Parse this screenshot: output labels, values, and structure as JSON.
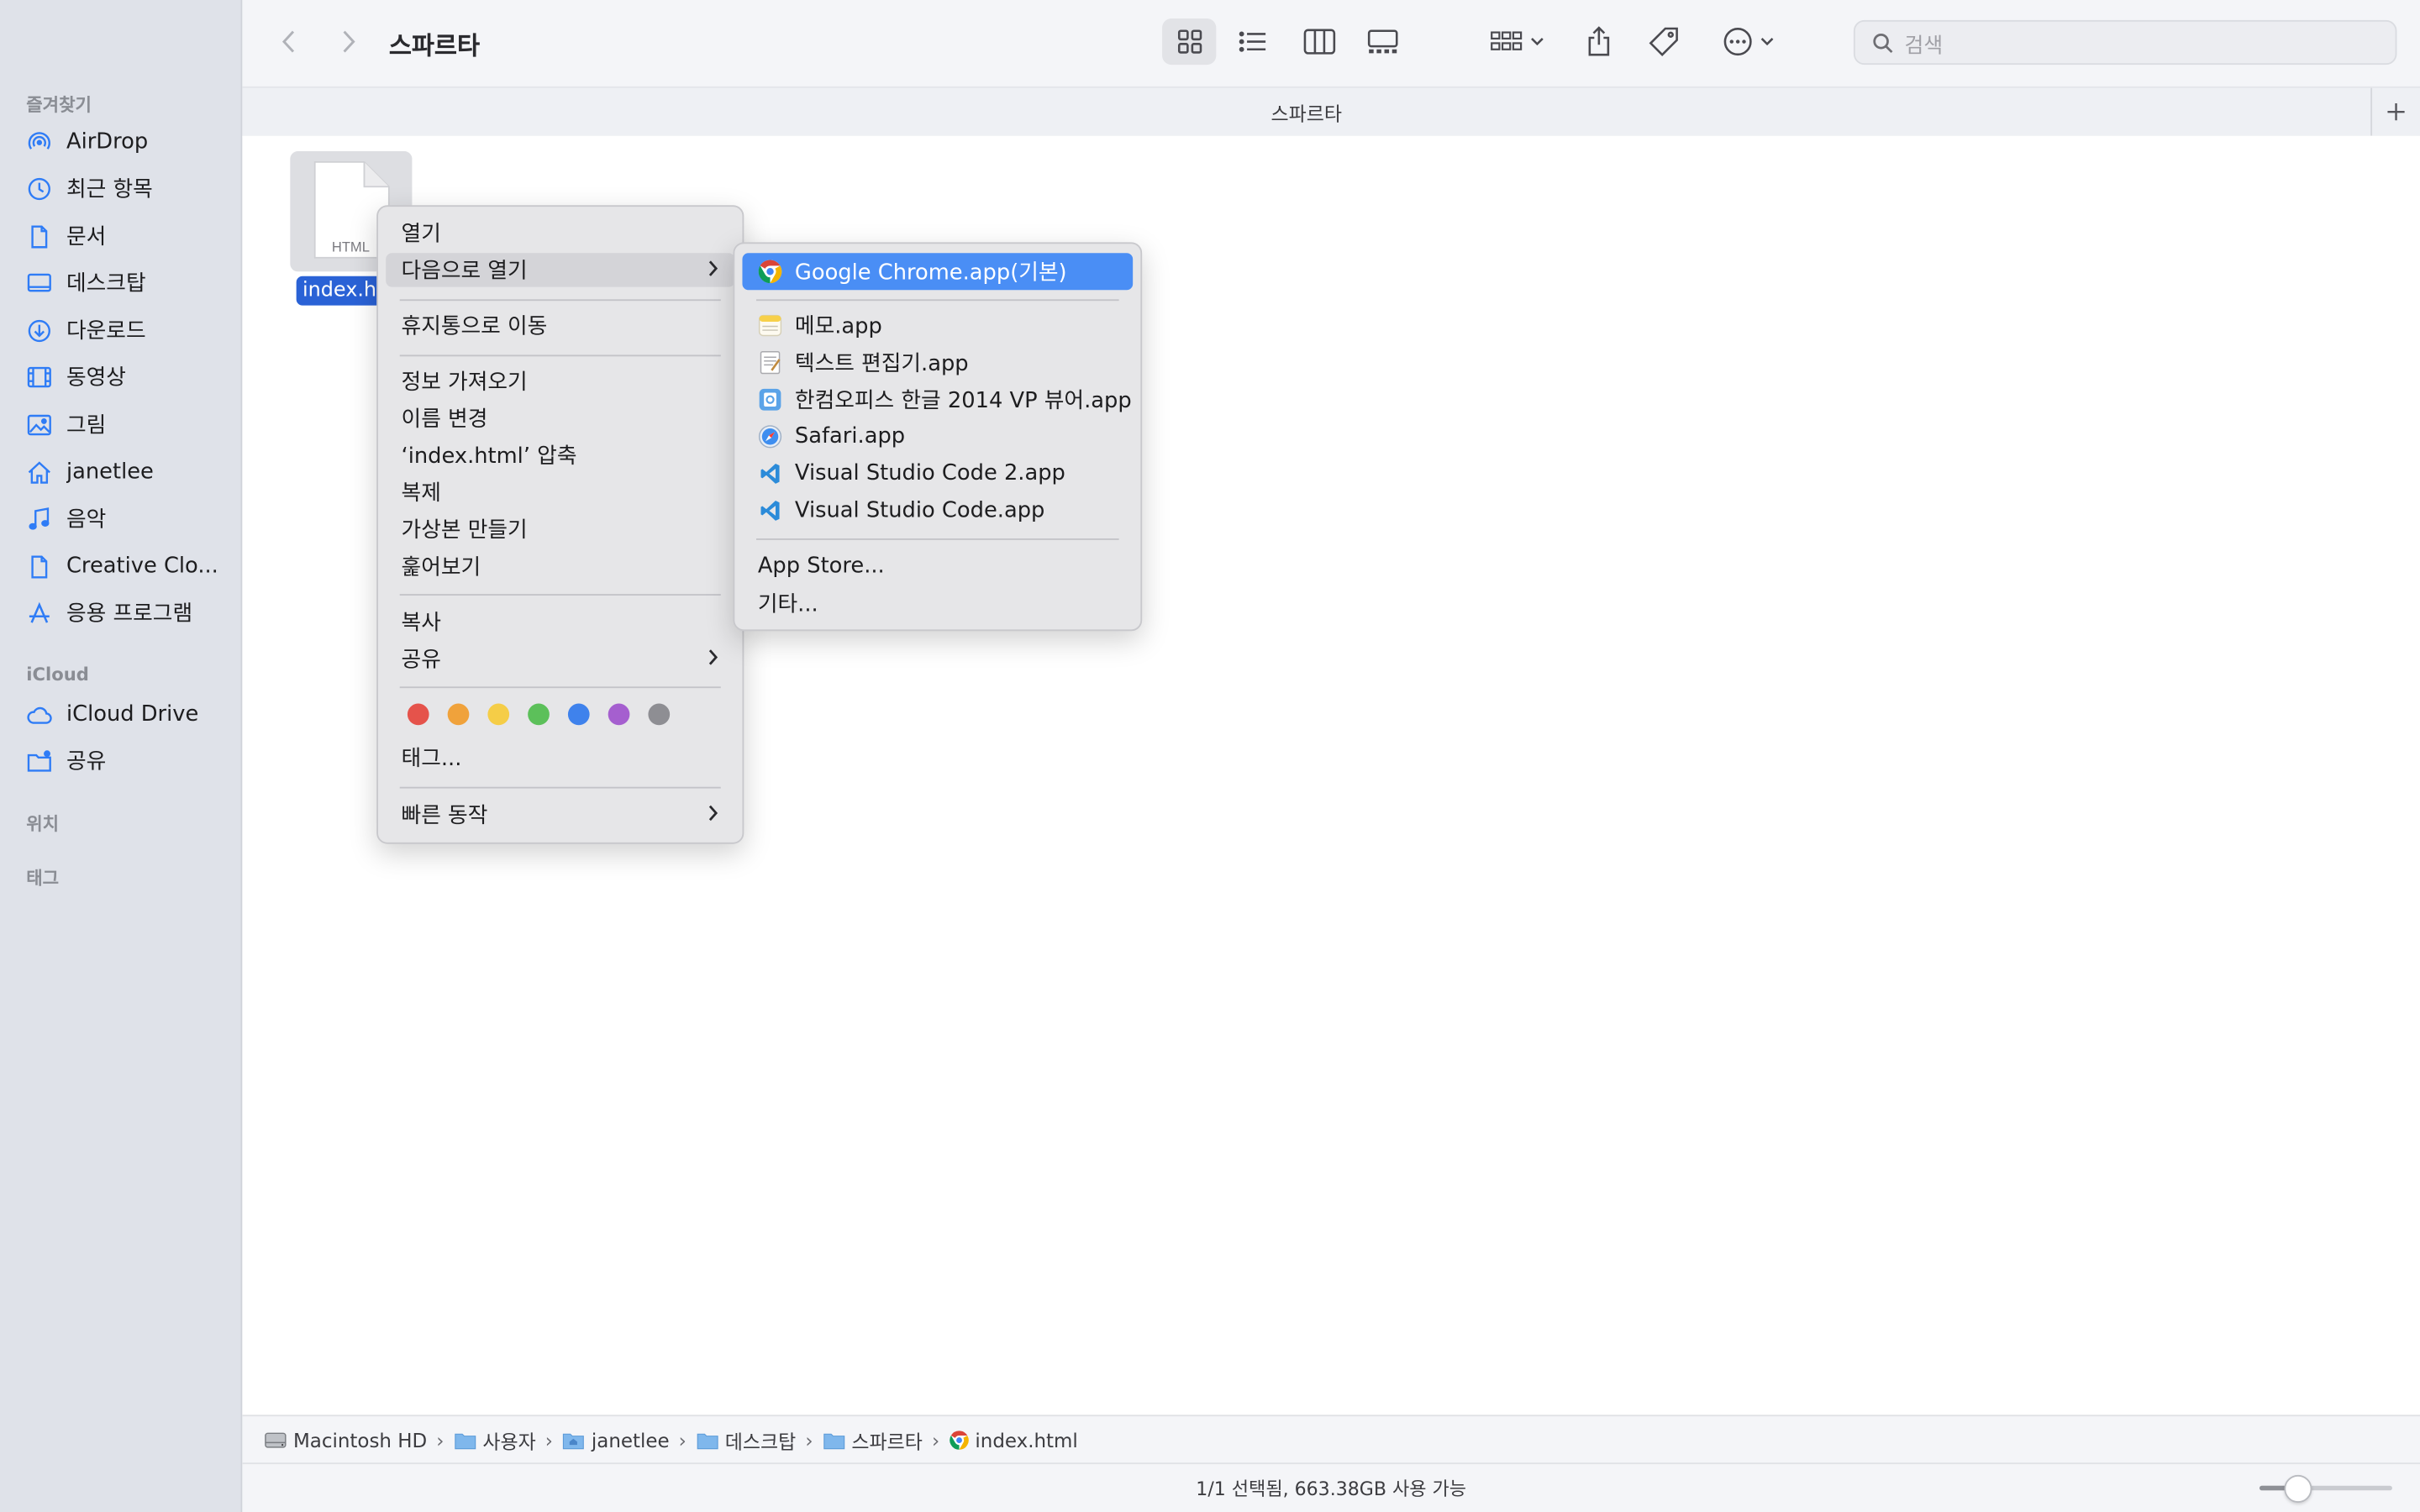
{
  "window": {
    "title": "스파르타",
    "tab_title": "스파르타"
  },
  "search": {
    "placeholder": "검색"
  },
  "sidebar": {
    "favorites_heading": "즐겨찾기",
    "favorites": [
      {
        "label": "AirDrop",
        "icon": "airdrop-icon"
      },
      {
        "label": "최근 항목",
        "icon": "clock-icon"
      },
      {
        "label": "문서",
        "icon": "document-icon"
      },
      {
        "label": "데스크탑",
        "icon": "desktop-icon"
      },
      {
        "label": "다운로드",
        "icon": "download-icon"
      },
      {
        "label": "동영상",
        "icon": "film-icon"
      },
      {
        "label": "그림",
        "icon": "photo-icon"
      },
      {
        "label": "janetlee",
        "icon": "home-icon"
      },
      {
        "label": "음악",
        "icon": "music-icon"
      },
      {
        "label": "Creative Clo...",
        "icon": "document-icon"
      },
      {
        "label": "응용 프로그램",
        "icon": "applications-icon"
      }
    ],
    "icloud_heading": "iCloud",
    "icloud": [
      {
        "label": "iCloud Drive",
        "icon": "cloud-icon"
      },
      {
        "label": "공유",
        "icon": "shared-folder-icon"
      }
    ],
    "locations_heading": "위치",
    "tags_heading": "태그"
  },
  "file": {
    "name": "index.ht",
    "type_label": "HTML"
  },
  "context_menu": {
    "open": "열기",
    "open_with": "다음으로 열기",
    "move_to_trash": "휴지통으로 이동",
    "get_info": "정보 가져오기",
    "rename": "이름 변경",
    "compress": "‘index.html’ 압축",
    "duplicate": "복제",
    "make_alias": "가상본 만들기",
    "quick_look": "훑어보기",
    "copy": "복사",
    "share": "공유",
    "tags": "태그...",
    "quick_actions": "빠른 동작",
    "tag_colors": [
      "#e5534b",
      "#f0a23b",
      "#f5cd47",
      "#5cc05a",
      "#3f82ec",
      "#a55fcf",
      "#8e8e93"
    ]
  },
  "open_with_menu": {
    "default_app": "Google Chrome.app(기본)",
    "apps": [
      {
        "label": "메모.app",
        "icon": "notes-icon"
      },
      {
        "label": "텍스트 편집기.app",
        "icon": "textedit-icon"
      },
      {
        "label": "한컴오피스 한글 2014 VP 뷰어.app",
        "icon": "hancom-icon"
      },
      {
        "label": "Safari.app",
        "icon": "safari-icon"
      },
      {
        "label": "Visual Studio Code 2.app",
        "icon": "vscode-icon"
      },
      {
        "label": "Visual Studio Code.app",
        "icon": "vscode-icon"
      }
    ],
    "app_store": "App Store...",
    "other": "기타..."
  },
  "pathbar": {
    "items": [
      "Macintosh HD",
      "사용자",
      "janetlee",
      "데스크탑",
      "스파르타",
      "index.html"
    ]
  },
  "status": {
    "text": "1/1 선택됨, 663.38GB 사용 가능"
  },
  "colors": {
    "accent": "#4a8ef5",
    "selection": "#2a62d6",
    "sidebar_bg": "#dfe2e9"
  }
}
